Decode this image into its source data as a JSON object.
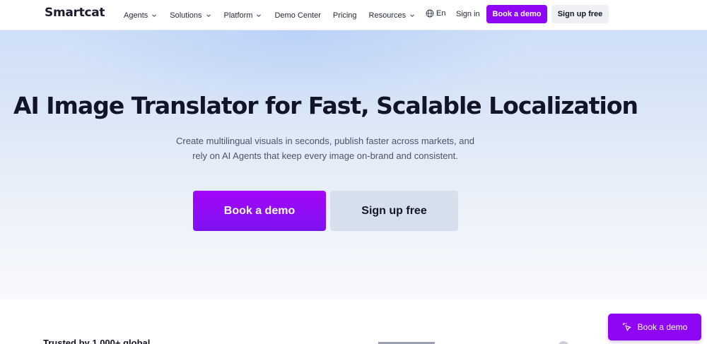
{
  "header": {
    "logo": "Smartcat",
    "nav": [
      {
        "label": "Agents",
        "dropdown": true
      },
      {
        "label": "Solutions",
        "dropdown": true
      },
      {
        "label": "Platform",
        "dropdown": true
      },
      {
        "label": "Demo Center",
        "dropdown": false
      },
      {
        "label": "Pricing",
        "dropdown": false
      },
      {
        "label": "Resources",
        "dropdown": true
      }
    ],
    "language": "En",
    "language_icon": "globe-icon",
    "sign_in": "Sign in",
    "book_demo": "Book a demo",
    "sign_up": "Sign up free"
  },
  "hero": {
    "title": "AI Image Translator for Fast, Scalable Localization",
    "subtitle_line1": "Create multilingual visuals in seconds, publish faster across markets, and",
    "subtitle_line2": "rely on AI Agents that keep every image on-brand and consistent.",
    "book_demo": "Book a demo",
    "sign_up": "Sign up free"
  },
  "bottom": {
    "partial_text": "Trusted by 1,000+ global..."
  },
  "floating_cta": {
    "label": "Book a demo",
    "icon": "cursor-click-icon"
  },
  "colors": {
    "brand_purple": "#8f06f2",
    "hero_gradient_top": "#cfdff7",
    "secondary_button": "#d6e0ec",
    "text_dark": "#121526"
  }
}
